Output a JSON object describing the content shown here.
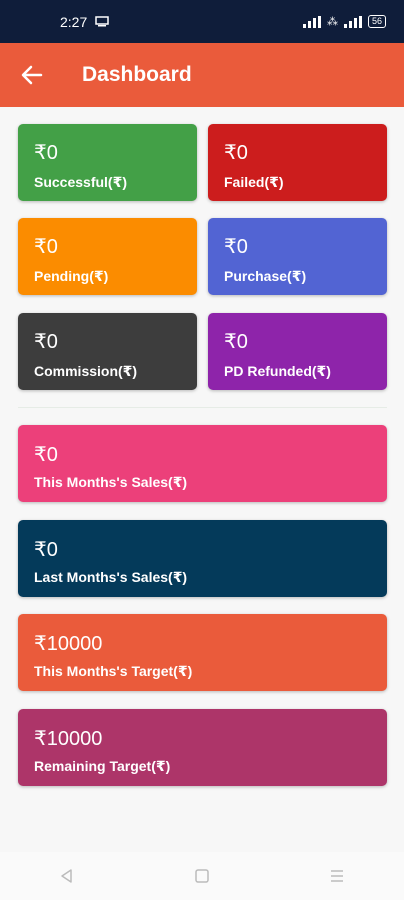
{
  "status_bar": {
    "time": "2:27",
    "battery": "56"
  },
  "app_bar": {
    "title": "Dashboard"
  },
  "cards": {
    "successful": {
      "amount": "₹0",
      "label": "Successful(₹)",
      "color": "#43a047"
    },
    "failed": {
      "amount": "₹0",
      "label": "Failed(₹)",
      "color": "#cc1d1d"
    },
    "pending": {
      "amount": "₹0",
      "label": "Pending(₹)",
      "color": "#fb8c00"
    },
    "purchase": {
      "amount": "₹0",
      "label": "Purchase(₹)",
      "color": "#5264d3"
    },
    "commission": {
      "amount": "₹0",
      "label": "Commission(₹)",
      "color": "#3d3d3d"
    },
    "pd_refunded": {
      "amount": "₹0",
      "label": "PD Refunded(₹)",
      "color": "#8e24aa"
    },
    "this_month_sales": {
      "amount": "₹0",
      "label": "This Months's Sales(₹)",
      "color": "#ec407a"
    },
    "last_month_sales": {
      "amount": "₹0",
      "label": "Last Months's Sales(₹)",
      "color": "#043a5a"
    },
    "this_month_target": {
      "amount": "₹10000",
      "label": "This Months's Target(₹)",
      "color": "#ea5b3b"
    },
    "remaining_target": {
      "amount": "₹10000",
      "label": "Remaining Target(₹)",
      "color": "#ad3569"
    }
  }
}
